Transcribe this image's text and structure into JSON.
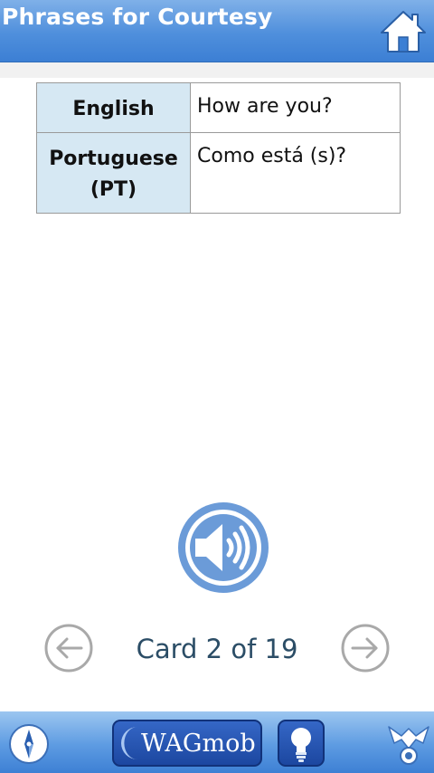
{
  "header": {
    "title": "Phrases for Courtesy",
    "home_icon": "home-icon"
  },
  "card": {
    "rows": [
      {
        "language": "English",
        "text": "How are you?"
      },
      {
        "language": "Portuguese (PT)",
        "text": "Como está (s)?"
      }
    ]
  },
  "audio": {
    "icon": "speaker-icon"
  },
  "navigation": {
    "counter": "Card 2 of 19",
    "prev_icon": "arrow-left-icon",
    "next_icon": "arrow-right-icon"
  },
  "footer": {
    "brand": "WAGmob",
    "icons": [
      "compass-icon",
      "lightbulb-icon",
      "settings-icon"
    ]
  },
  "colors": {
    "header_blue": "#4f8fdc",
    "label_cell_bg": "#d6e8f3",
    "icon_blue": "#6b9bd8",
    "counter_text": "#2b4d66"
  }
}
